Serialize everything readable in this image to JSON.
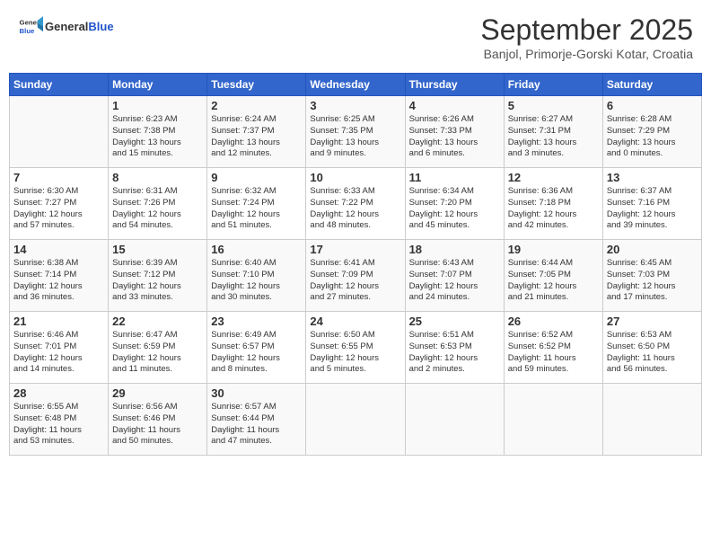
{
  "header": {
    "logo_general": "General",
    "logo_blue": "Blue",
    "month_title": "September 2025",
    "location": "Banjol, Primorje-Gorski Kotar, Croatia"
  },
  "days_of_week": [
    "Sunday",
    "Monday",
    "Tuesday",
    "Wednesday",
    "Thursday",
    "Friday",
    "Saturday"
  ],
  "weeks": [
    [
      {
        "day": "",
        "info": ""
      },
      {
        "day": "1",
        "info": "Sunrise: 6:23 AM\nSunset: 7:38 PM\nDaylight: 13 hours\nand 15 minutes."
      },
      {
        "day": "2",
        "info": "Sunrise: 6:24 AM\nSunset: 7:37 PM\nDaylight: 13 hours\nand 12 minutes."
      },
      {
        "day": "3",
        "info": "Sunrise: 6:25 AM\nSunset: 7:35 PM\nDaylight: 13 hours\nand 9 minutes."
      },
      {
        "day": "4",
        "info": "Sunrise: 6:26 AM\nSunset: 7:33 PM\nDaylight: 13 hours\nand 6 minutes."
      },
      {
        "day": "5",
        "info": "Sunrise: 6:27 AM\nSunset: 7:31 PM\nDaylight: 13 hours\nand 3 minutes."
      },
      {
        "day": "6",
        "info": "Sunrise: 6:28 AM\nSunset: 7:29 PM\nDaylight: 13 hours\nand 0 minutes."
      }
    ],
    [
      {
        "day": "7",
        "info": "Sunrise: 6:30 AM\nSunset: 7:27 PM\nDaylight: 12 hours\nand 57 minutes."
      },
      {
        "day": "8",
        "info": "Sunrise: 6:31 AM\nSunset: 7:26 PM\nDaylight: 12 hours\nand 54 minutes."
      },
      {
        "day": "9",
        "info": "Sunrise: 6:32 AM\nSunset: 7:24 PM\nDaylight: 12 hours\nand 51 minutes."
      },
      {
        "day": "10",
        "info": "Sunrise: 6:33 AM\nSunset: 7:22 PM\nDaylight: 12 hours\nand 48 minutes."
      },
      {
        "day": "11",
        "info": "Sunrise: 6:34 AM\nSunset: 7:20 PM\nDaylight: 12 hours\nand 45 minutes."
      },
      {
        "day": "12",
        "info": "Sunrise: 6:36 AM\nSunset: 7:18 PM\nDaylight: 12 hours\nand 42 minutes."
      },
      {
        "day": "13",
        "info": "Sunrise: 6:37 AM\nSunset: 7:16 PM\nDaylight: 12 hours\nand 39 minutes."
      }
    ],
    [
      {
        "day": "14",
        "info": "Sunrise: 6:38 AM\nSunset: 7:14 PM\nDaylight: 12 hours\nand 36 minutes."
      },
      {
        "day": "15",
        "info": "Sunrise: 6:39 AM\nSunset: 7:12 PM\nDaylight: 12 hours\nand 33 minutes."
      },
      {
        "day": "16",
        "info": "Sunrise: 6:40 AM\nSunset: 7:10 PM\nDaylight: 12 hours\nand 30 minutes."
      },
      {
        "day": "17",
        "info": "Sunrise: 6:41 AM\nSunset: 7:09 PM\nDaylight: 12 hours\nand 27 minutes."
      },
      {
        "day": "18",
        "info": "Sunrise: 6:43 AM\nSunset: 7:07 PM\nDaylight: 12 hours\nand 24 minutes."
      },
      {
        "day": "19",
        "info": "Sunrise: 6:44 AM\nSunset: 7:05 PM\nDaylight: 12 hours\nand 21 minutes."
      },
      {
        "day": "20",
        "info": "Sunrise: 6:45 AM\nSunset: 7:03 PM\nDaylight: 12 hours\nand 17 minutes."
      }
    ],
    [
      {
        "day": "21",
        "info": "Sunrise: 6:46 AM\nSunset: 7:01 PM\nDaylight: 12 hours\nand 14 minutes."
      },
      {
        "day": "22",
        "info": "Sunrise: 6:47 AM\nSunset: 6:59 PM\nDaylight: 12 hours\nand 11 minutes."
      },
      {
        "day": "23",
        "info": "Sunrise: 6:49 AM\nSunset: 6:57 PM\nDaylight: 12 hours\nand 8 minutes."
      },
      {
        "day": "24",
        "info": "Sunrise: 6:50 AM\nSunset: 6:55 PM\nDaylight: 12 hours\nand 5 minutes."
      },
      {
        "day": "25",
        "info": "Sunrise: 6:51 AM\nSunset: 6:53 PM\nDaylight: 12 hours\nand 2 minutes."
      },
      {
        "day": "26",
        "info": "Sunrise: 6:52 AM\nSunset: 6:52 PM\nDaylight: 11 hours\nand 59 minutes."
      },
      {
        "day": "27",
        "info": "Sunrise: 6:53 AM\nSunset: 6:50 PM\nDaylight: 11 hours\nand 56 minutes."
      }
    ],
    [
      {
        "day": "28",
        "info": "Sunrise: 6:55 AM\nSunset: 6:48 PM\nDaylight: 11 hours\nand 53 minutes."
      },
      {
        "day": "29",
        "info": "Sunrise: 6:56 AM\nSunset: 6:46 PM\nDaylight: 11 hours\nand 50 minutes."
      },
      {
        "day": "30",
        "info": "Sunrise: 6:57 AM\nSunset: 6:44 PM\nDaylight: 11 hours\nand 47 minutes."
      },
      {
        "day": "",
        "info": ""
      },
      {
        "day": "",
        "info": ""
      },
      {
        "day": "",
        "info": ""
      },
      {
        "day": "",
        "info": ""
      }
    ]
  ]
}
